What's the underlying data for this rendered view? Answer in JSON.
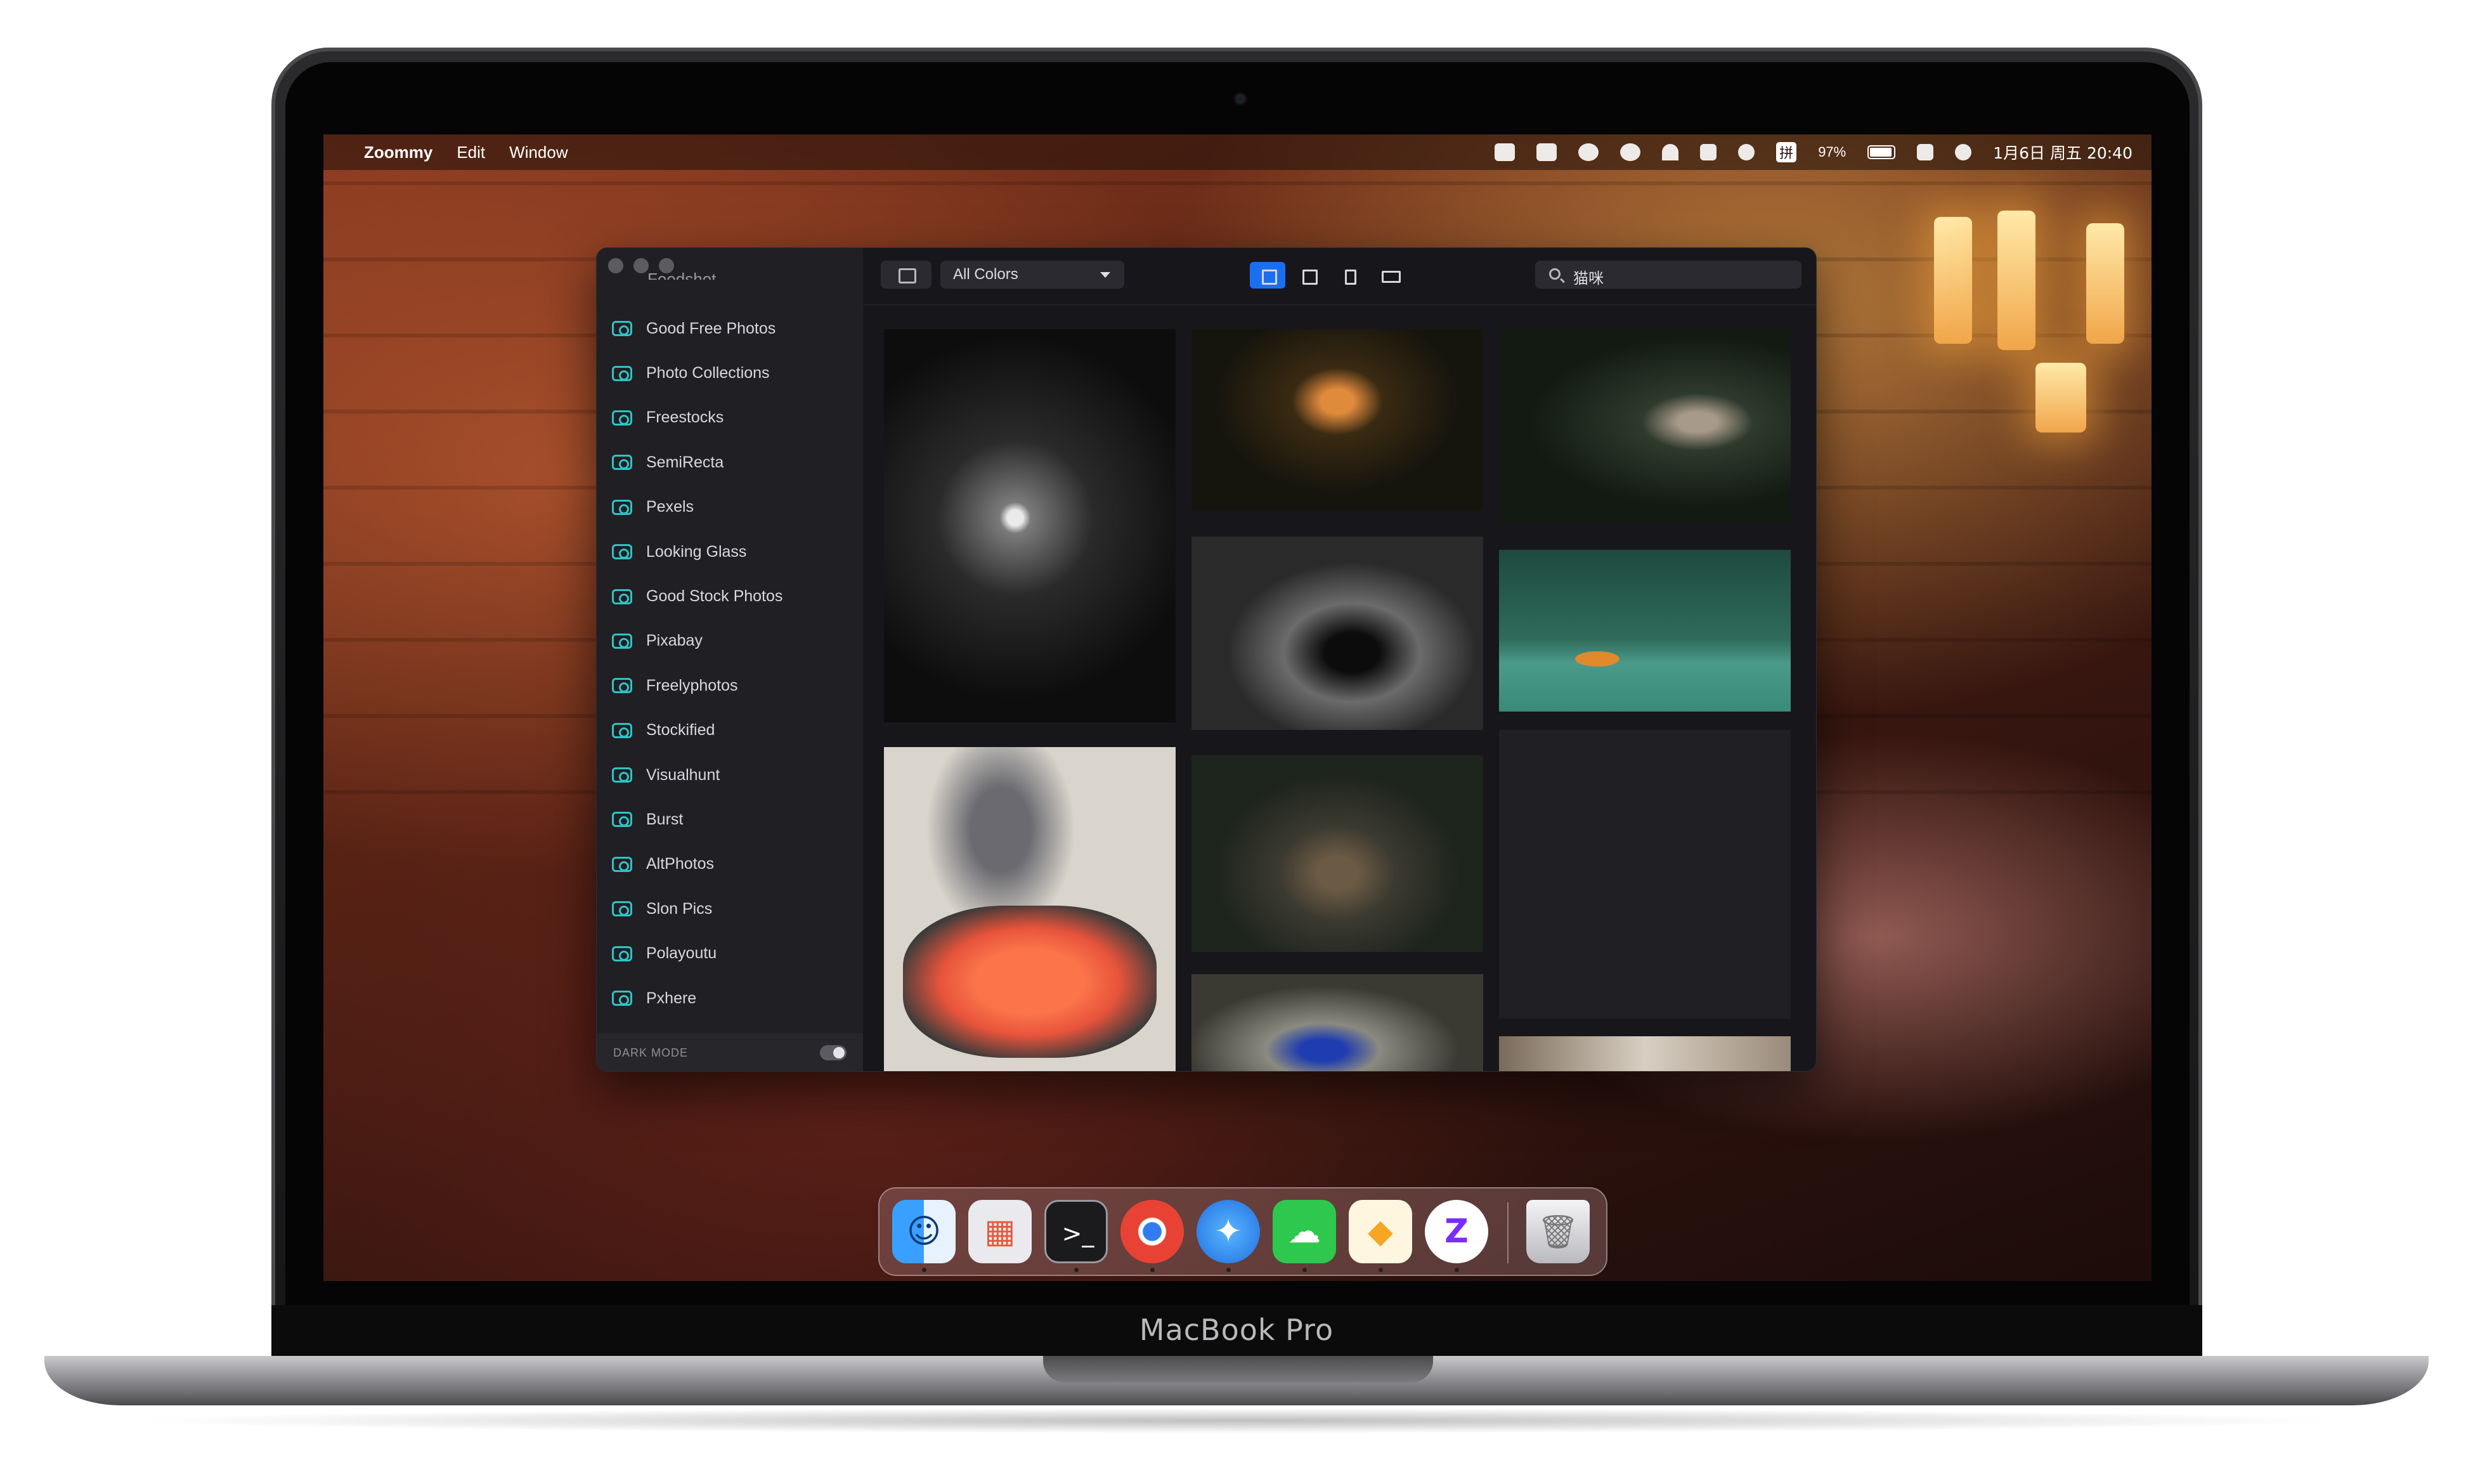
{
  "laptop": {
    "brand_label": "MacBook Pro"
  },
  "menubar": {
    "apple_glyph": "",
    "app_name": "Zoommy",
    "menus": [
      "Edit",
      "Window"
    ],
    "status_icons": [
      "picture-icon",
      "notification-icon",
      "wechat-icon",
      "user-icon",
      "wifi-icon",
      "volume-icon",
      "search-icon",
      "input-method-icon"
    ],
    "input_method": "拼",
    "battery_percent": "97%",
    "datetime": "1月6日 周五  20:40"
  },
  "window": {
    "sidebar": {
      "cut_off_label": "Foodshot",
      "sources": [
        "Good Free Photos",
        "Photo Collections",
        "Freestocks",
        "SemiRecta",
        "Pexels",
        "Looking Glass",
        "Good Stock Photos",
        "Pixabay",
        "Freelyphotos",
        "Stockified",
        "Visualhunt",
        "Burst",
        "AltPhotos",
        "Slon Pics",
        "Polayoutu",
        "Pxhere"
      ],
      "dark_mode_label": "DARK MODE",
      "dark_mode_on": true,
      "accent_color": "#2ec4c4"
    },
    "toolbar": {
      "color_filter": "All Colors",
      "view_modes": [
        "grid-view-icon",
        "square-view-icon",
        "portrait-view-icon",
        "landscape-view-icon"
      ],
      "active_view": "grid-view-icon",
      "search_query": "猫咪",
      "active_color": "#1a6ff0"
    },
    "gallery": {
      "photos": [
        "cat-in-dark-alley",
        "calico-cat-on-road",
        "kitten-in-doorway",
        "tuxedo-cat-street",
        "cat-on-green-steps",
        "cat-with-sashimi",
        "owls-on-log",
        "blue-bird-on-rocks",
        "empty-placeholder",
        "building-photo-partial"
      ]
    }
  },
  "dock": {
    "apps": [
      {
        "name": "Finder",
        "icon": "finder-icon",
        "glyph": "☺"
      },
      {
        "name": "Launchpad",
        "icon": "launchpad-icon",
        "glyph": "▦"
      },
      {
        "name": "Terminal",
        "icon": "terminal-icon",
        "glyph": ">_"
      },
      {
        "name": "Chrome",
        "icon": "chrome-icon",
        "glyph": "◉"
      },
      {
        "name": "Safari",
        "icon": "safari-icon",
        "glyph": "✦"
      },
      {
        "name": "WeChat",
        "icon": "wechat-icon",
        "glyph": "☁"
      },
      {
        "name": "Sketch",
        "icon": "sketch-icon",
        "glyph": "◆"
      },
      {
        "name": "Zoommy",
        "icon": "zoommy-icon",
        "glyph": "Z"
      },
      {
        "name": "Trash",
        "icon": "trash-icon",
        "glyph": "🗑"
      }
    ]
  }
}
